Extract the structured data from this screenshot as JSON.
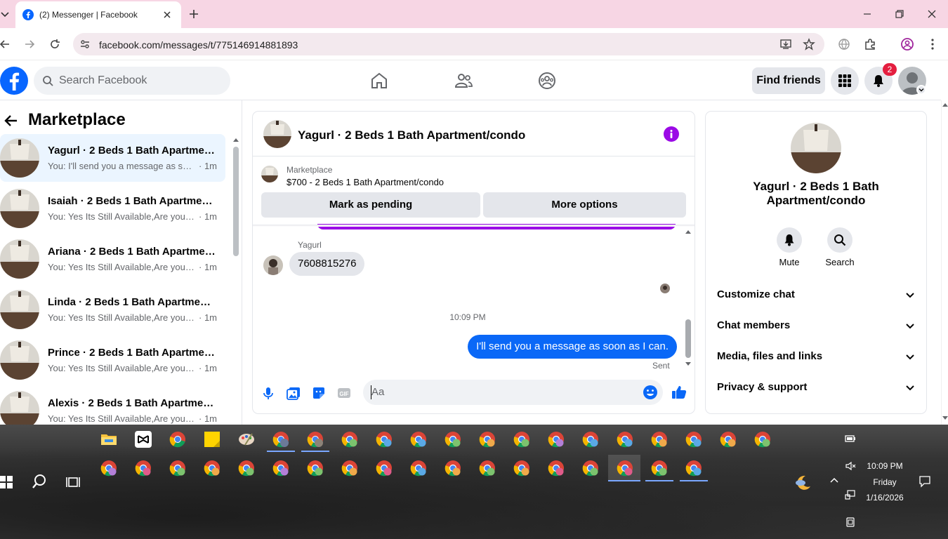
{
  "browser": {
    "tab_title": "(2) Messenger | Facebook",
    "url": "facebook.com/messages/t/775146914881893"
  },
  "fb_header": {
    "search_placeholder": "Search Facebook",
    "find_friends": "Find friends",
    "notification_count": "2"
  },
  "left": {
    "title": "Marketplace",
    "conversations": [
      {
        "name": "Yagurl · 2 Beds 1 Bath Apartment/condo",
        "last": "You: I'll send you a message as soon as I can.",
        "time": "· 1m"
      },
      {
        "name": "Isaiah · 2 Beds 1 Bath Apartment/condo",
        "last": "You: Yes Its Still Available,Are you interested?",
        "time": "· 1m"
      },
      {
        "name": "Ariana · 2 Beds 1 Bath Apartment/condo",
        "last": "You: Yes Its Still Available,Are you interested?",
        "time": "· 1m"
      },
      {
        "name": "Linda · 2 Beds 1 Bath Apartment/condo",
        "last": "You: Yes Its Still Available,Are you interested?",
        "time": "· 1m"
      },
      {
        "name": "Prince · 2 Beds 1 Bath Apartment/condo",
        "last": "You: Yes Its Still Available,Are you interested?",
        "time": "· 1m"
      },
      {
        "name": "Alexis · 2 Beds 1 Bath Apartment/condo",
        "last": "You: Yes Its Still Available,Are you interested?",
        "time": "· 1m"
      }
    ]
  },
  "chat": {
    "title": "Yagurl · 2 Beds 1 Bath Apartment/condo",
    "marketplace_label": "Marketplace",
    "marketplace_item": "$700 - 2 Beds 1 Bath Apartment/condo",
    "mark_pending": "Mark as pending",
    "more_options": "More options",
    "sender_name": "Yagurl",
    "incoming_message": "7608815276",
    "timestamp": "10:09 PM",
    "outgoing_message": "I'll send you a message as soon as I can.",
    "sent_label": "Sent",
    "composer_placeholder": "Aa"
  },
  "right": {
    "name": "Yagurl · 2 Beds 1 Bath Apartment/condo",
    "mute": "Mute",
    "search": "Search",
    "sections": [
      "Customize chat",
      "Chat members",
      "Media, files and links",
      "Privacy & support"
    ]
  },
  "taskbar": {
    "time": "10:09 PM",
    "day": "Friday",
    "date": "1/16/2026"
  },
  "colors": {
    "fb_blue": "#0866ff",
    "messenger_blue": "#0a68f7",
    "accent_purple": "#9b0ae6",
    "chrome_tab_bar": "#f7d6e4"
  }
}
